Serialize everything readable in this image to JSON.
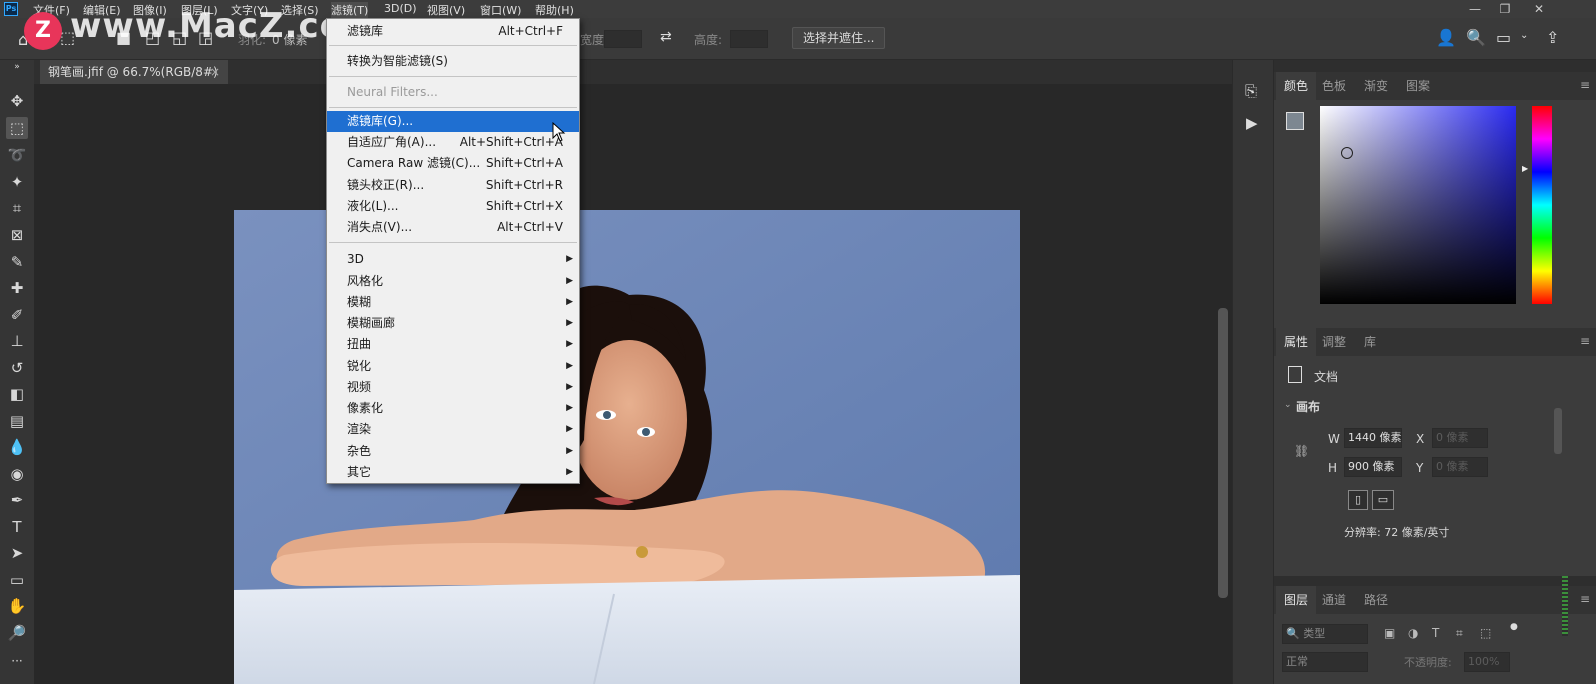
{
  "app": {
    "logo": "Ps",
    "menu": [
      "文件(F)",
      "编辑(E)",
      "图像(I)",
      "图层(L)",
      "文字(Y)",
      "选择(S)",
      "滤镜(T)",
      "3D(D)",
      "视图(V)",
      "窗口(W)",
      "帮助(H)"
    ],
    "active_menu": "滤镜(T)",
    "window_buttons": [
      "—",
      "❐",
      "✕"
    ]
  },
  "watermark": {
    "badge": "Z",
    "text": "www.MacZ.com"
  },
  "options_bar": {
    "feather_label": "羽化:",
    "feather_value": "0 像素",
    "width_label": "宽度:",
    "height_label": "高度:",
    "select_mask_button": "选择并遮住..."
  },
  "document_tab": {
    "title": "钢笔画.jfif @ 66.7%(RGB/8#)",
    "close": "×"
  },
  "filter_menu": {
    "items_top": [
      {
        "label": "滤镜库",
        "shortcut": "Alt+Ctrl+F"
      },
      {
        "label": "转换为智能滤镜(S)",
        "shortcut": ""
      },
      {
        "label": "Neural Filters...",
        "shortcut": "",
        "disabled": true
      }
    ],
    "items_mid": [
      {
        "label": "滤镜库(G)...",
        "shortcut": "",
        "highlighted": true
      },
      {
        "label": "自适应广角(A)...",
        "shortcut": "Alt+Shift+Ctrl+A"
      },
      {
        "label": "Camera Raw 滤镜(C)...",
        "shortcut": "Shift+Ctrl+A"
      },
      {
        "label": "镜头校正(R)...",
        "shortcut": "Shift+Ctrl+R"
      },
      {
        "label": "液化(L)...",
        "shortcut": "Shift+Ctrl+X"
      },
      {
        "label": "消失点(V)...",
        "shortcut": "Alt+Ctrl+V"
      }
    ],
    "submenus": [
      "3D",
      "风格化",
      "模糊",
      "模糊画廊",
      "扭曲",
      "锐化",
      "视频",
      "像素化",
      "渲染",
      "杂色",
      "其它"
    ]
  },
  "color_panel": {
    "tabs": [
      "颜色",
      "色板",
      "渐变",
      "图案"
    ],
    "active_tab": "颜色",
    "hue_color": "#2a2af0"
  },
  "properties_panel": {
    "tabs": [
      "属性",
      "调整",
      "库"
    ],
    "active_tab": "属性",
    "doc_label": "文档",
    "section": "画布",
    "w_label": "W",
    "w_value": "1440 像素",
    "h_label": "H",
    "h_value": "900 像素",
    "x_label": "X",
    "x_value": "0 像素",
    "y_label": "Y",
    "y_value": "0 像素",
    "resolution": "分辨率: 72 像素/英寸"
  },
  "layers_panel": {
    "tabs": [
      "图层",
      "通道",
      "路径"
    ],
    "active_tab": "图层",
    "filter_placeholder": "类型",
    "blend_mode": "正常",
    "opacity_label": "不透明度:",
    "opacity_value": "100%"
  }
}
